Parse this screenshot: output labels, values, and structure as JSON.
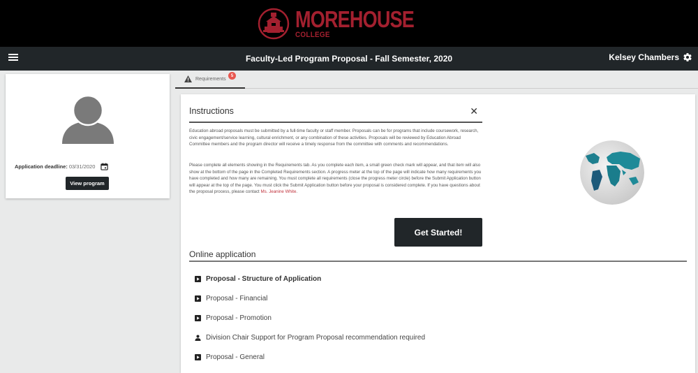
{
  "brand": {
    "name": "MOREHOUSE",
    "subtitle": "COLLEGE",
    "color": "#a3202f"
  },
  "app_bar": {
    "menu_icon": "hamburger-menu-icon",
    "title": "Faculty-Led Program Proposal - Fall Semester, 2020",
    "user_name": "Kelsey Chambers",
    "settings_icon": "gear-icon"
  },
  "profile": {
    "avatar_icon": "person-silhouette-icon",
    "deadline_label": "Application deadline:",
    "deadline_value": "03/31/2020",
    "calendar_icon": "calendar-icon",
    "view_button": "View program"
  },
  "tabs": [
    {
      "label": "Requirements",
      "icon": "warning-triangle-icon",
      "badge": "5",
      "active": true
    }
  ],
  "instructions": {
    "title": "Instructions",
    "close_icon": "close-icon",
    "paragraph1": "Education abroad proposals must be submitted by a full-time faculty or staff member. Proposals can be for programs that include coursework, research, civic engagement/service learning, cultural enrichment, or any combination of these activities. Proposals will be reviewed by Education Abroad Committee members and the program director will receive a timely response from the committee with comments and recommendations.",
    "paragraph2": "Please complete all elements showing in the Requirements tab. As you complete each item, a small green check mark will appear, and that item will also show at the bottom of the page in the Completed Requirements section. A progress meter at the top of the page will indicate how many requirements you have completed and how many are remaining. You must complete all requirements (close the progress meter circle) before the Submit Application button will appear at the top of the page.  You must click the Submit Application button before your proposal is considered complete.  If you have questions about the proposal process, please contact",
    "contact_name": "Ms. Jeanine White",
    "paragraph2_end": ".",
    "image": "world-globe-image",
    "start_button": "Get Started!"
  },
  "online_application": {
    "title": "Online application",
    "items": [
      {
        "label": "Proposal - Structure of Application",
        "icon": "form-icon",
        "bold": true
      },
      {
        "label": "Proposal - Financial",
        "icon": "form-icon",
        "bold": false
      },
      {
        "label": "Proposal - Promotion",
        "icon": "form-icon",
        "bold": false
      },
      {
        "label": "Division Chair Support for Program Proposal recommendation required",
        "icon": "person-icon",
        "bold": false
      },
      {
        "label": "Proposal - General",
        "icon": "form-icon",
        "bold": false
      }
    ]
  }
}
